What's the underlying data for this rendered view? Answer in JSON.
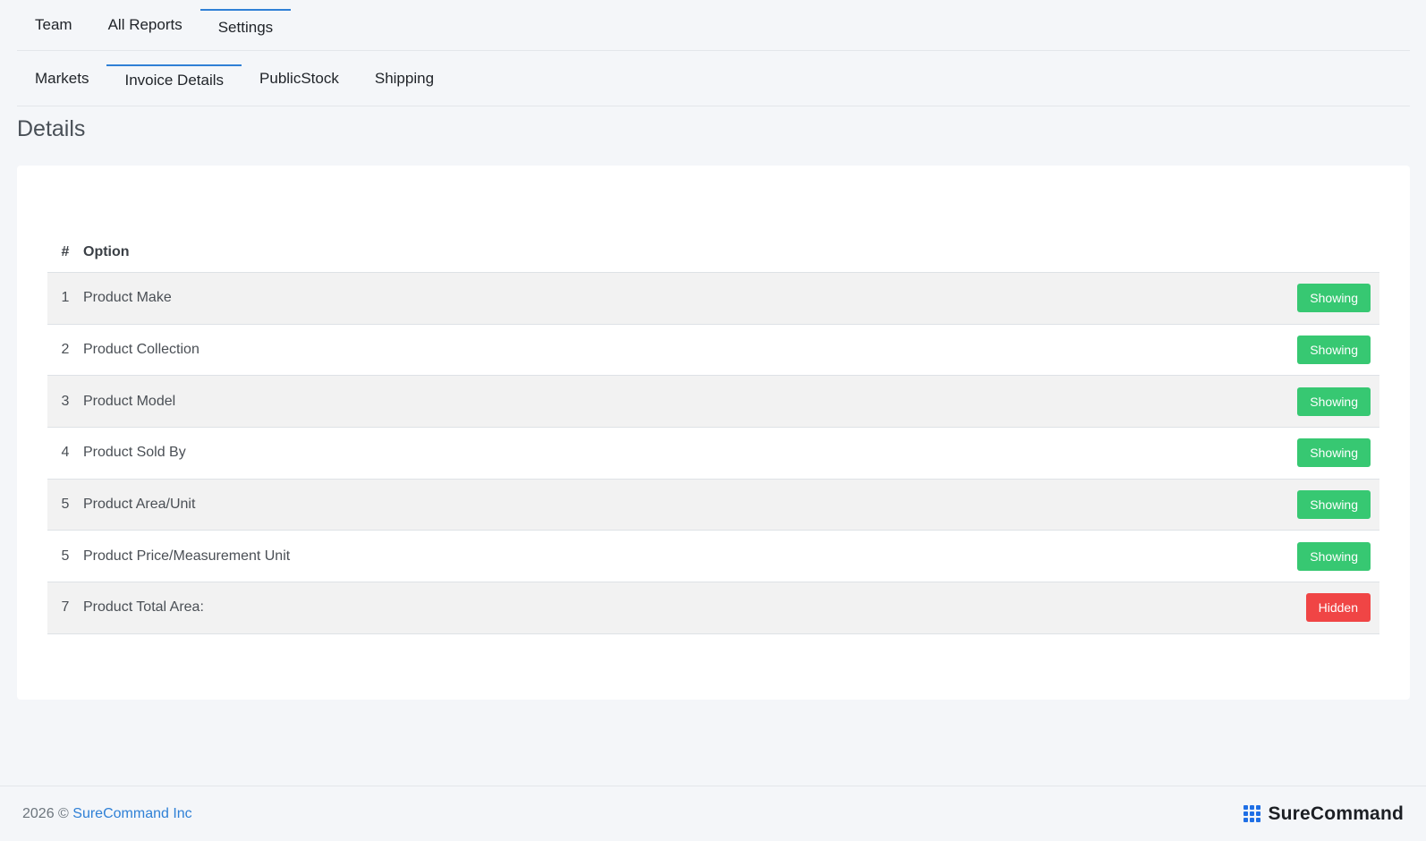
{
  "top_tabs": [
    {
      "label": "Team",
      "active": false
    },
    {
      "label": "All Reports",
      "active": false
    },
    {
      "label": "Settings",
      "active": true
    }
  ],
  "sub_tabs": [
    {
      "label": "Markets",
      "active": false
    },
    {
      "label": "Invoice Details",
      "active": true
    },
    {
      "label": "PublicStock",
      "active": false
    },
    {
      "label": "Shipping",
      "active": false
    }
  ],
  "page": {
    "title": "Details"
  },
  "table": {
    "headers": {
      "num": "#",
      "option": "Option"
    },
    "rows": [
      {
        "num": "1",
        "option": "Product Make",
        "status": "Showing"
      },
      {
        "num": "2",
        "option": "Product Collection",
        "status": "Showing"
      },
      {
        "num": "3",
        "option": "Product Model",
        "status": "Showing"
      },
      {
        "num": "4",
        "option": "Product Sold By",
        "status": "Showing"
      },
      {
        "num": "5",
        "option": "Product Area/Unit",
        "status": "Showing"
      },
      {
        "num": "5",
        "option": "Product Price/Measurement Unit",
        "status": "Showing"
      },
      {
        "num": "7",
        "option": "Product Total Area:",
        "status": "Hidden"
      }
    ]
  },
  "footer": {
    "year": "2026 ©",
    "company_link": "SureCommand Inc",
    "brand_name": "SureCommand",
    "brand_icon": "grid-dots-icon"
  },
  "colors": {
    "accent": "#2f80d6",
    "showing": "#37c872",
    "hidden": "#f04545",
    "brand_icon": "#1f6fe5"
  }
}
